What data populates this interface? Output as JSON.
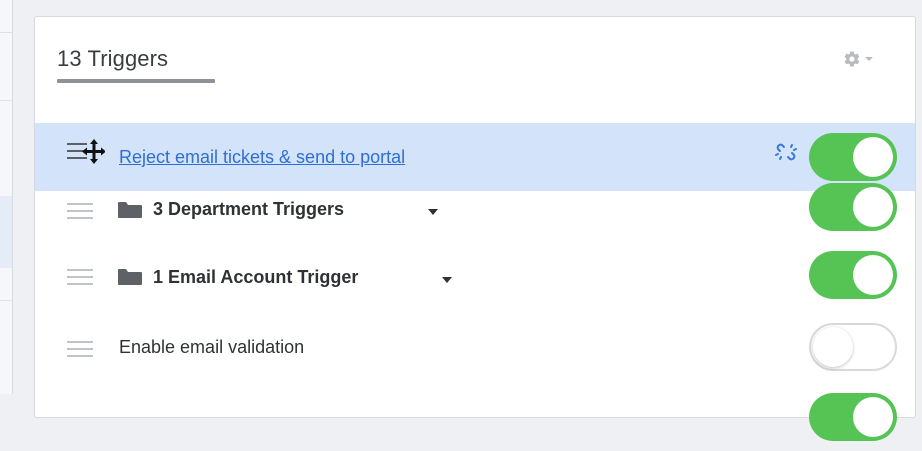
{
  "panel": {
    "title": "13 Triggers",
    "settings_icon": "gear-icon"
  },
  "triggers": [
    {
      "label": "Reject email tickets & send to portal",
      "type": "trigger",
      "enabled": true,
      "selected": true,
      "link_state": "unlinked"
    },
    {
      "label": "3 Department Triggers",
      "type": "group",
      "enabled": true
    },
    {
      "label": "1 Email Account Trigger",
      "type": "group",
      "enabled": true
    },
    {
      "label": "Enable email validation",
      "type": "trigger",
      "enabled": false
    }
  ],
  "colors": {
    "toggle_on": "#55c454",
    "selected_row": "#d3e3fa",
    "link": "#2f6ed3"
  }
}
